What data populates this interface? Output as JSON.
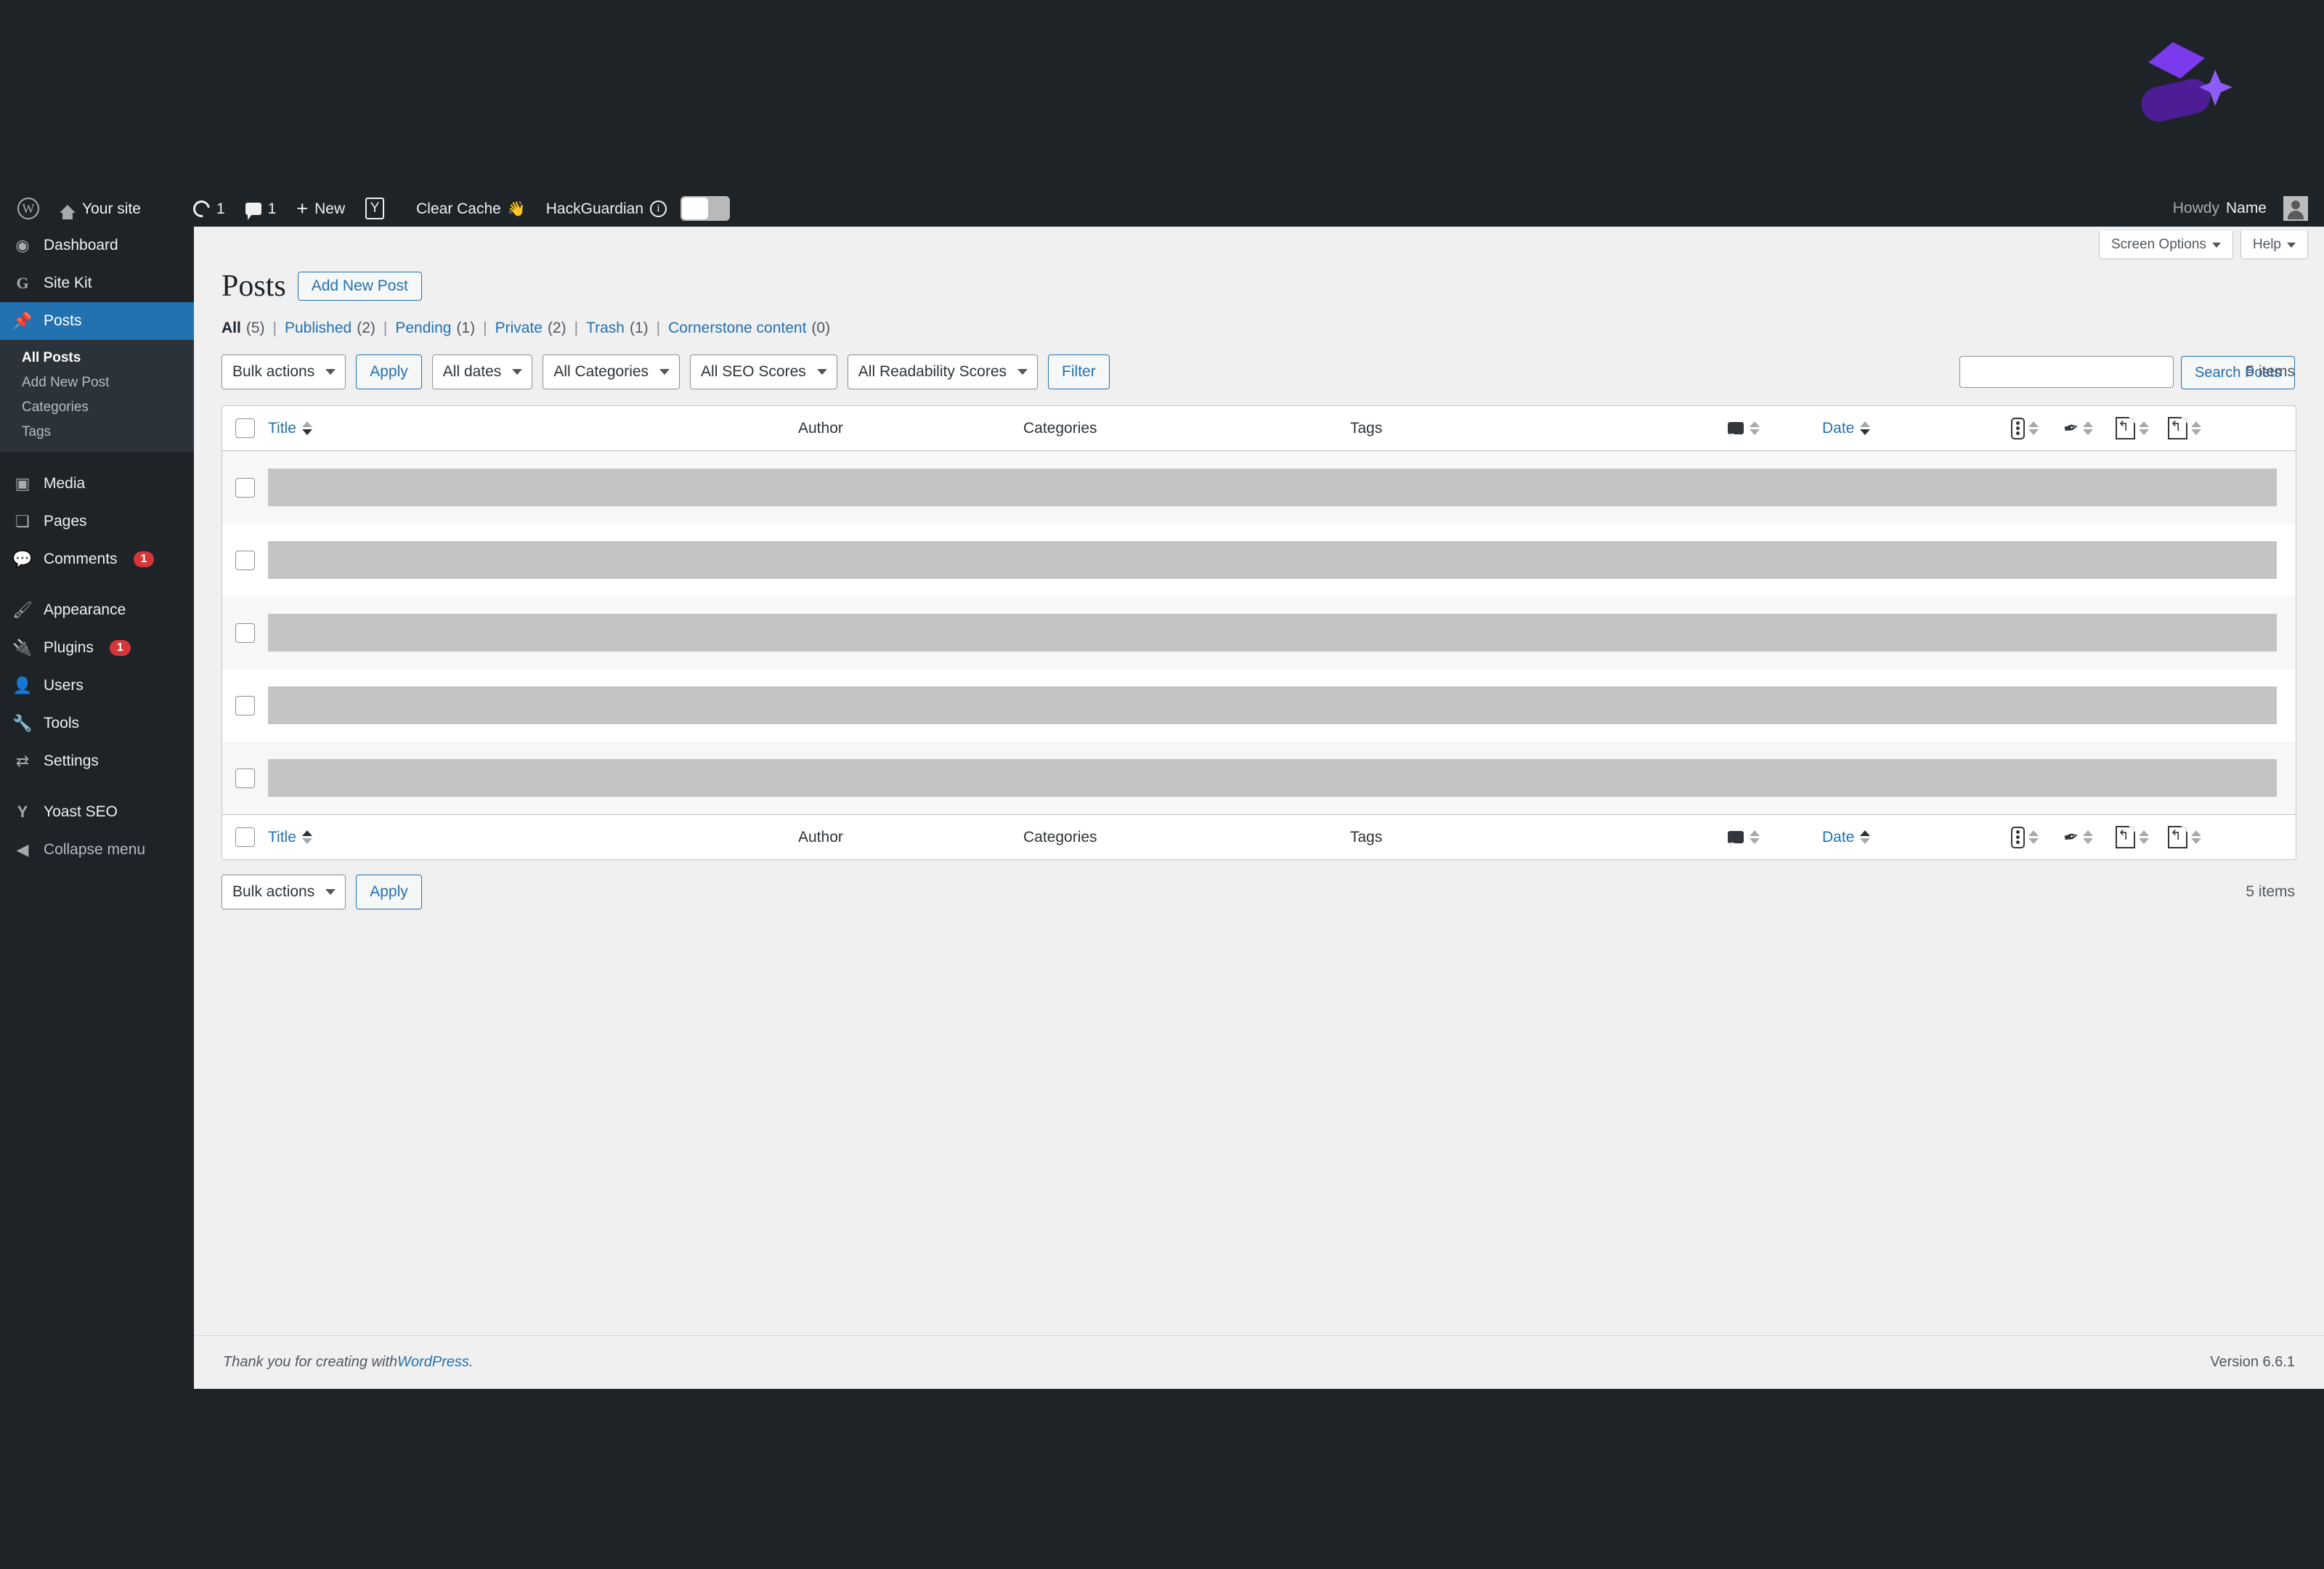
{
  "brand": {
    "logo_name": "purple-diamond-star-logo",
    "color": "#7c3aed",
    "color_dark": "#4c1d95"
  },
  "adminbar": {
    "wp_logo": "wordpress-logo-icon",
    "site_name": "Your site",
    "updates_count": "1",
    "comments_count": "1",
    "new_label": "New",
    "yoast_label": "yoast-seo-icon",
    "clear_cache_label": "Clear Cache",
    "clear_cache_emoji": "👋",
    "hackguardian_label": "HackGuardian",
    "toggle_state": "off",
    "howdy_label": "Howdy",
    "user_name": "Name"
  },
  "sidebar": {
    "items": [
      {
        "label": "Dashboard",
        "icon": "dashboard-icon",
        "glyph": "◉",
        "current": false
      },
      {
        "label": "Site Kit",
        "icon": "google-site-kit-icon",
        "glyph": "G",
        "current": false
      },
      {
        "label": "Posts",
        "icon": "pin-icon",
        "glyph": "📌",
        "current": true
      },
      {
        "label": "Media",
        "icon": "media-icon",
        "glyph": "▣",
        "current": false
      },
      {
        "label": "Pages",
        "icon": "pages-icon",
        "glyph": "❏",
        "current": false
      },
      {
        "label": "Comments",
        "icon": "comment-icon",
        "glyph": "💬",
        "current": false,
        "badge": "1"
      },
      {
        "label": "Appearance",
        "icon": "brush-icon",
        "glyph": "🖌",
        "current": false
      },
      {
        "label": "Plugins",
        "icon": "plug-icon",
        "glyph": "🔌",
        "current": false,
        "badge": "1"
      },
      {
        "label": "Users",
        "icon": "user-icon",
        "glyph": "👤",
        "current": false
      },
      {
        "label": "Tools",
        "icon": "wrench-icon",
        "glyph": "🔧",
        "current": false
      },
      {
        "label": "Settings",
        "icon": "settings-sliders-icon",
        "glyph": "⇄",
        "current": false
      },
      {
        "label": "Yoast SEO",
        "icon": "yoast-seo-icon",
        "glyph": "Y",
        "current": false
      }
    ],
    "submenu": [
      {
        "label": "All Posts",
        "current": true
      },
      {
        "label": "Add New Post",
        "current": false
      },
      {
        "label": "Categories",
        "current": false
      },
      {
        "label": "Tags",
        "current": false
      }
    ],
    "collapse_label": "Collapse menu"
  },
  "screen": {
    "screen_options_label": "Screen Options",
    "help_label": "Help"
  },
  "page": {
    "title": "Posts",
    "add_new_label": "Add New Post"
  },
  "statuses": [
    {
      "label": "All",
      "count": "(5)",
      "current": true
    },
    {
      "label": "Published",
      "count": "(2)",
      "current": false
    },
    {
      "label": "Pending",
      "count": "(1)",
      "current": false
    },
    {
      "label": "Private",
      "count": "(2)",
      "current": false
    },
    {
      "label": "Trash",
      "count": "(1)",
      "current": false
    },
    {
      "label": "Cornerstone content",
      "count": "(0)",
      "current": false
    }
  ],
  "search": {
    "value": "",
    "placeholder": "",
    "button_label": "Search Posts"
  },
  "tablenav_top": {
    "bulk_actions": "Bulk actions",
    "apply_label": "Apply",
    "dates": "All dates",
    "categories": "All Categories",
    "seo_scores": "All SEO Scores",
    "readability_scores": "All Readability Scores",
    "filter_label": "Filter",
    "items_count": "5 items"
  },
  "tablenav_bottom": {
    "bulk_actions": "Bulk actions",
    "apply_label": "Apply",
    "items_count": "5 items"
  },
  "table": {
    "columns": {
      "title": "Title",
      "author": "Author",
      "categories": "Categories",
      "tags": "Tags",
      "comments": "comment-bubble-icon",
      "date": "Date",
      "seo_score": "seo-score-icon",
      "readability": "readability-feather-icon",
      "incoming_links": "incoming-links-icon",
      "outgoing_links": "outgoing-links-icon"
    },
    "rows": [
      {
        "redacted": true
      },
      {
        "redacted": true
      },
      {
        "redacted": true
      },
      {
        "redacted": true
      },
      {
        "redacted": true
      }
    ]
  },
  "footer": {
    "thanks_prefix": "Thank you for creating with ",
    "wordpress_link": "WordPress",
    "thanks_suffix": ".",
    "version": "Version 6.6.1"
  }
}
